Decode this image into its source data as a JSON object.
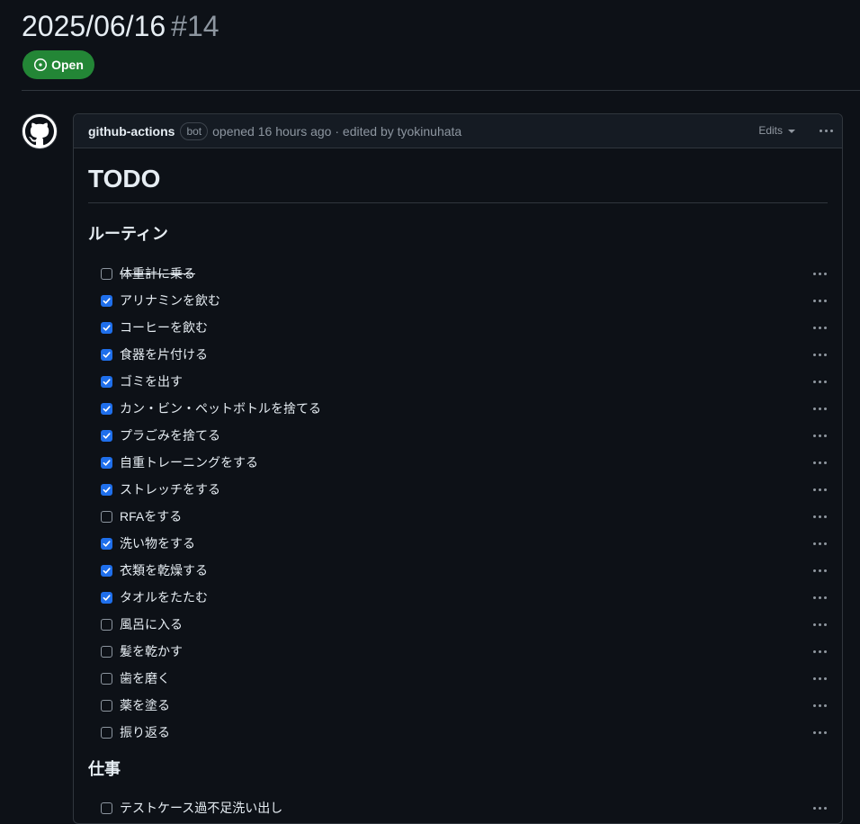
{
  "issue": {
    "title": "2025/06/16",
    "number": "#14",
    "state": "Open"
  },
  "comment": {
    "author": "github-actions",
    "bot_label": "bot",
    "meta": "opened 16 hours ago · edited by tyokinuhata",
    "edits_label": "Edits"
  },
  "body": {
    "heading": "TODO",
    "sections": [
      {
        "title": "ルーティン",
        "tasks": [
          {
            "text": "体重計に乗る",
            "checked": false,
            "strike": true
          },
          {
            "text": "アリナミンを飲む",
            "checked": true
          },
          {
            "text": "コーヒーを飲む",
            "checked": true
          },
          {
            "text": "食器を片付ける",
            "checked": true
          },
          {
            "text": "ゴミを出す",
            "checked": true
          },
          {
            "text": "カン・ビン・ペットボトルを捨てる",
            "checked": true
          },
          {
            "text": "プラごみを捨てる",
            "checked": true
          },
          {
            "text": "自重トレーニングをする",
            "checked": true
          },
          {
            "text": "ストレッチをする",
            "checked": true
          },
          {
            "text": "RFAをする",
            "checked": false
          },
          {
            "text": "洗い物をする",
            "checked": true
          },
          {
            "text": "衣類を乾燥する",
            "checked": true
          },
          {
            "text": "タオルをたたむ",
            "checked": true
          },
          {
            "text": "風呂に入る",
            "checked": false
          },
          {
            "text": "髪を乾かす",
            "checked": false
          },
          {
            "text": "歯を磨く",
            "checked": false
          },
          {
            "text": "薬を塗る",
            "checked": false
          },
          {
            "text": "振り返る",
            "checked": false
          }
        ]
      },
      {
        "title": "仕事",
        "tasks": [
          {
            "text": "テストケース過不足洗い出し",
            "checked": false
          }
        ]
      }
    ]
  }
}
